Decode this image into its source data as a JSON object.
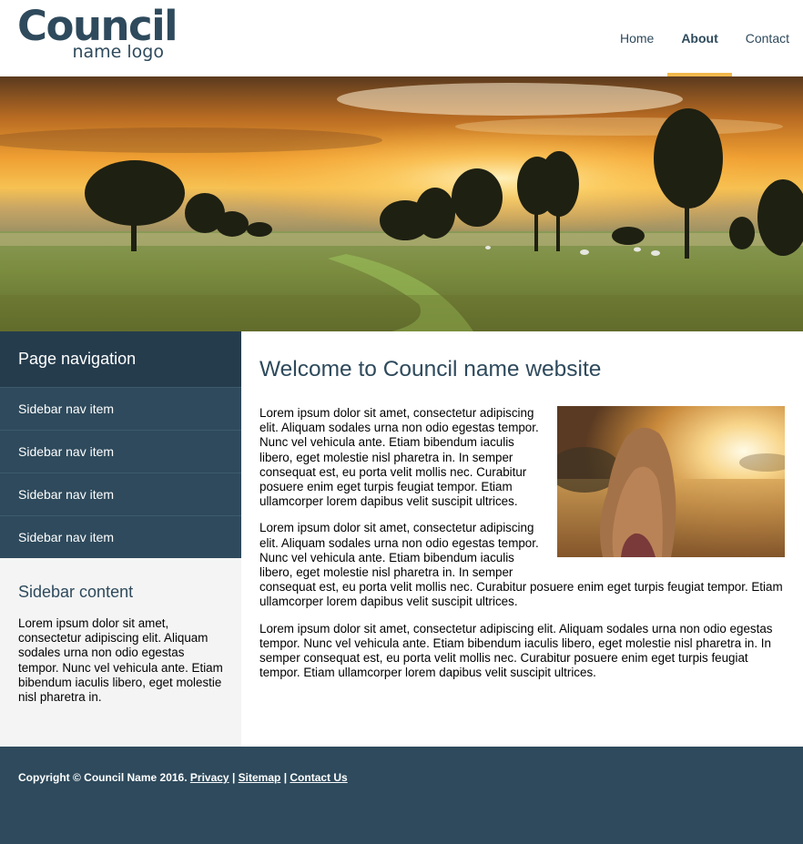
{
  "header": {
    "logo_main": "Council",
    "logo_sub": "name logo",
    "nav": [
      {
        "label": "Home"
      },
      {
        "label": "About"
      },
      {
        "label": "Contact"
      }
    ],
    "active_item": "About",
    "active_color": "#f2b84b"
  },
  "hero": {
    "image": "sunset-field-with-trees"
  },
  "sidebar": {
    "nav_title": "Page navigation",
    "nav_items": [
      {
        "label": "Sidebar nav item"
      },
      {
        "label": "Sidebar nav item"
      },
      {
        "label": "Sidebar nav item"
      },
      {
        "label": "Sidebar nav item"
      }
    ],
    "content_title": "Sidebar content",
    "content_text": "Lorem ipsum dolor sit amet, consectetur adipiscing elit. Aliquam sodales urna non odio egestas tempor. Nunc vel vehicula ante. Etiam bibendum iaculis libero, eget molestie nisl pharetra in."
  },
  "main": {
    "title": "Welcome to Council name website",
    "image": "girl-in-sunlit-field",
    "paragraphs": [
      "Lorem ipsum dolor sit amet, consectetur adipiscing elit. Aliquam sodales urna non odio egestas tempor. Nunc vel vehicula ante. Etiam bibendum iaculis libero, eget molestie nisl pharetra in. In semper consequat est, eu porta velit mollis nec. Curabitur posuere enim eget turpis feugiat tempor. Etiam ullamcorper lorem dapibus velit suscipit ultrices.",
      "Lorem ipsum dolor sit amet, consectetur adipiscing elit. Aliquam sodales urna non odio egestas tempor. Nunc vel vehicula ante. Etiam bibendum iaculis libero, eget molestie nisl pharetra in. In semper consequat est, eu porta velit mollis nec. Curabitur posuere enim eget turpis feugiat tempor. Etiam ullamcorper lorem dapibus velit suscipit ultrices.",
      "Lorem ipsum dolor sit amet, consectetur adipiscing elit. Aliquam sodales urna non odio egestas tempor. Nunc vel vehicula ante. Etiam bibendum iaculis libero, eget molestie nisl pharetra in. In semper consequat est, eu porta velit mollis nec. Curabitur posuere enim eget turpis feugiat tempor. Etiam ullamcorper lorem dapibus velit suscipit ultrices."
    ]
  },
  "footer": {
    "copyright": "Copyright © Council Name 2016.",
    "links": [
      "Privacy",
      "Sitemap",
      "Contact Us"
    ],
    "separator": "|"
  },
  "colors": {
    "primary": "#2e4a5c",
    "primary_dark": "#253c4d",
    "accent": "#f2b84b",
    "sidebar_bg": "#f4f4f4"
  }
}
